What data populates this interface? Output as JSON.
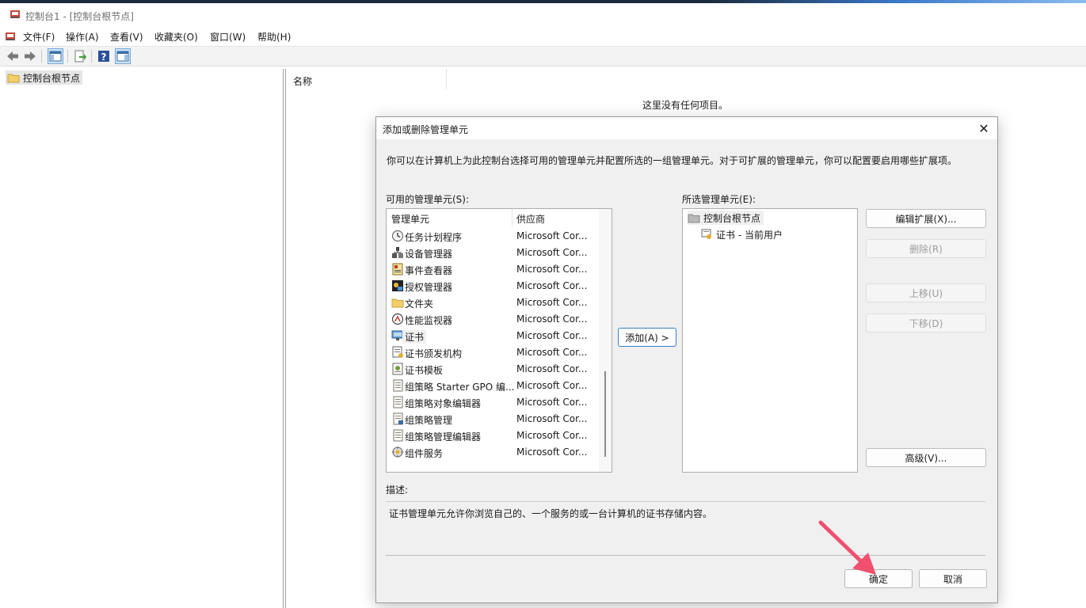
{
  "window": {
    "title": "控制台1 - [控制台根节点]"
  },
  "menu": [
    "文件(F)",
    "操作(A)",
    "查看(V)",
    "收藏夹(O)",
    "窗口(W)",
    "帮助(H)"
  ],
  "toolbar": {
    "icons": [
      "back-icon",
      "forward-icon",
      "show-hide-console-tree-icon",
      "export-list-icon",
      "help-icon",
      "show-hide-action-pane-icon"
    ]
  },
  "tree": {
    "root": "控制台根节点"
  },
  "content": {
    "column_name": "名称",
    "empty_message": "这里没有任何项目。"
  },
  "dialog": {
    "title": "添加或删除管理单元",
    "intro": "你可以在计算机上为此控制台选择可用的管理单元并配置所选的一组管理单元。对于可扩展的管理单元，你可以配置要启用哪些扩展项。",
    "available_label": "可用的管理单元(S):",
    "available_columns": [
      "管理单元",
      "供应商"
    ],
    "available_items": [
      {
        "name": "任务计划程序",
        "vendor": "Microsoft Cor...",
        "icon": "clock-icon"
      },
      {
        "name": "设备管理器",
        "vendor": "Microsoft Cor...",
        "icon": "device-manager-icon"
      },
      {
        "name": "事件查看器",
        "vendor": "Microsoft Cor...",
        "icon": "event-viewer-icon"
      },
      {
        "name": "授权管理器",
        "vendor": "Microsoft Cor...",
        "icon": "authorization-manager-icon"
      },
      {
        "name": "文件夹",
        "vendor": "Microsoft Cor...",
        "icon": "folder-icon"
      },
      {
        "name": "性能监视器",
        "vendor": "Microsoft Cor...",
        "icon": "performance-monitor-icon"
      },
      {
        "name": "证书",
        "vendor": "Microsoft Cor...",
        "icon": "certificates-icon"
      },
      {
        "name": "证书颁发机构",
        "vendor": "Microsoft Cor...",
        "icon": "certificate-authority-icon"
      },
      {
        "name": "证书模板",
        "vendor": "Microsoft Cor...",
        "icon": "certificate-templates-icon"
      },
      {
        "name": "组策略 Starter GPO 编...",
        "vendor": "Microsoft Cor...",
        "icon": "policy-icon"
      },
      {
        "name": "组策略对象编辑器",
        "vendor": "Microsoft Cor...",
        "icon": "policy-icon"
      },
      {
        "name": "组策略管理",
        "vendor": "Microsoft Cor...",
        "icon": "policy-management-icon"
      },
      {
        "name": "组策略管理编辑器",
        "vendor": "Microsoft Cor...",
        "icon": "policy-icon"
      },
      {
        "name": "组件服务",
        "vendor": "Microsoft Cor...",
        "icon": "component-services-icon"
      }
    ],
    "add_button": "添加(A) >",
    "selected_label": "所选管理单元(E):",
    "selected_root": "控制台根节点",
    "selected_child": "证书 - 当前用户",
    "buttons": {
      "edit_extensions": "编辑扩展(X)...",
      "remove": "删除(R)",
      "move_up": "上移(U)",
      "move_down": "下移(D)",
      "advanced": "高级(V)...",
      "ok": "确定",
      "cancel": "取消"
    },
    "description_label": "描述:",
    "description_text": "证书管理单元允许你浏览自己的、一个服务的或一台计算机的证书存储内容。"
  },
  "colors": {
    "annotation_arrow": "#f0506e",
    "accent": "#3c7fc4"
  }
}
